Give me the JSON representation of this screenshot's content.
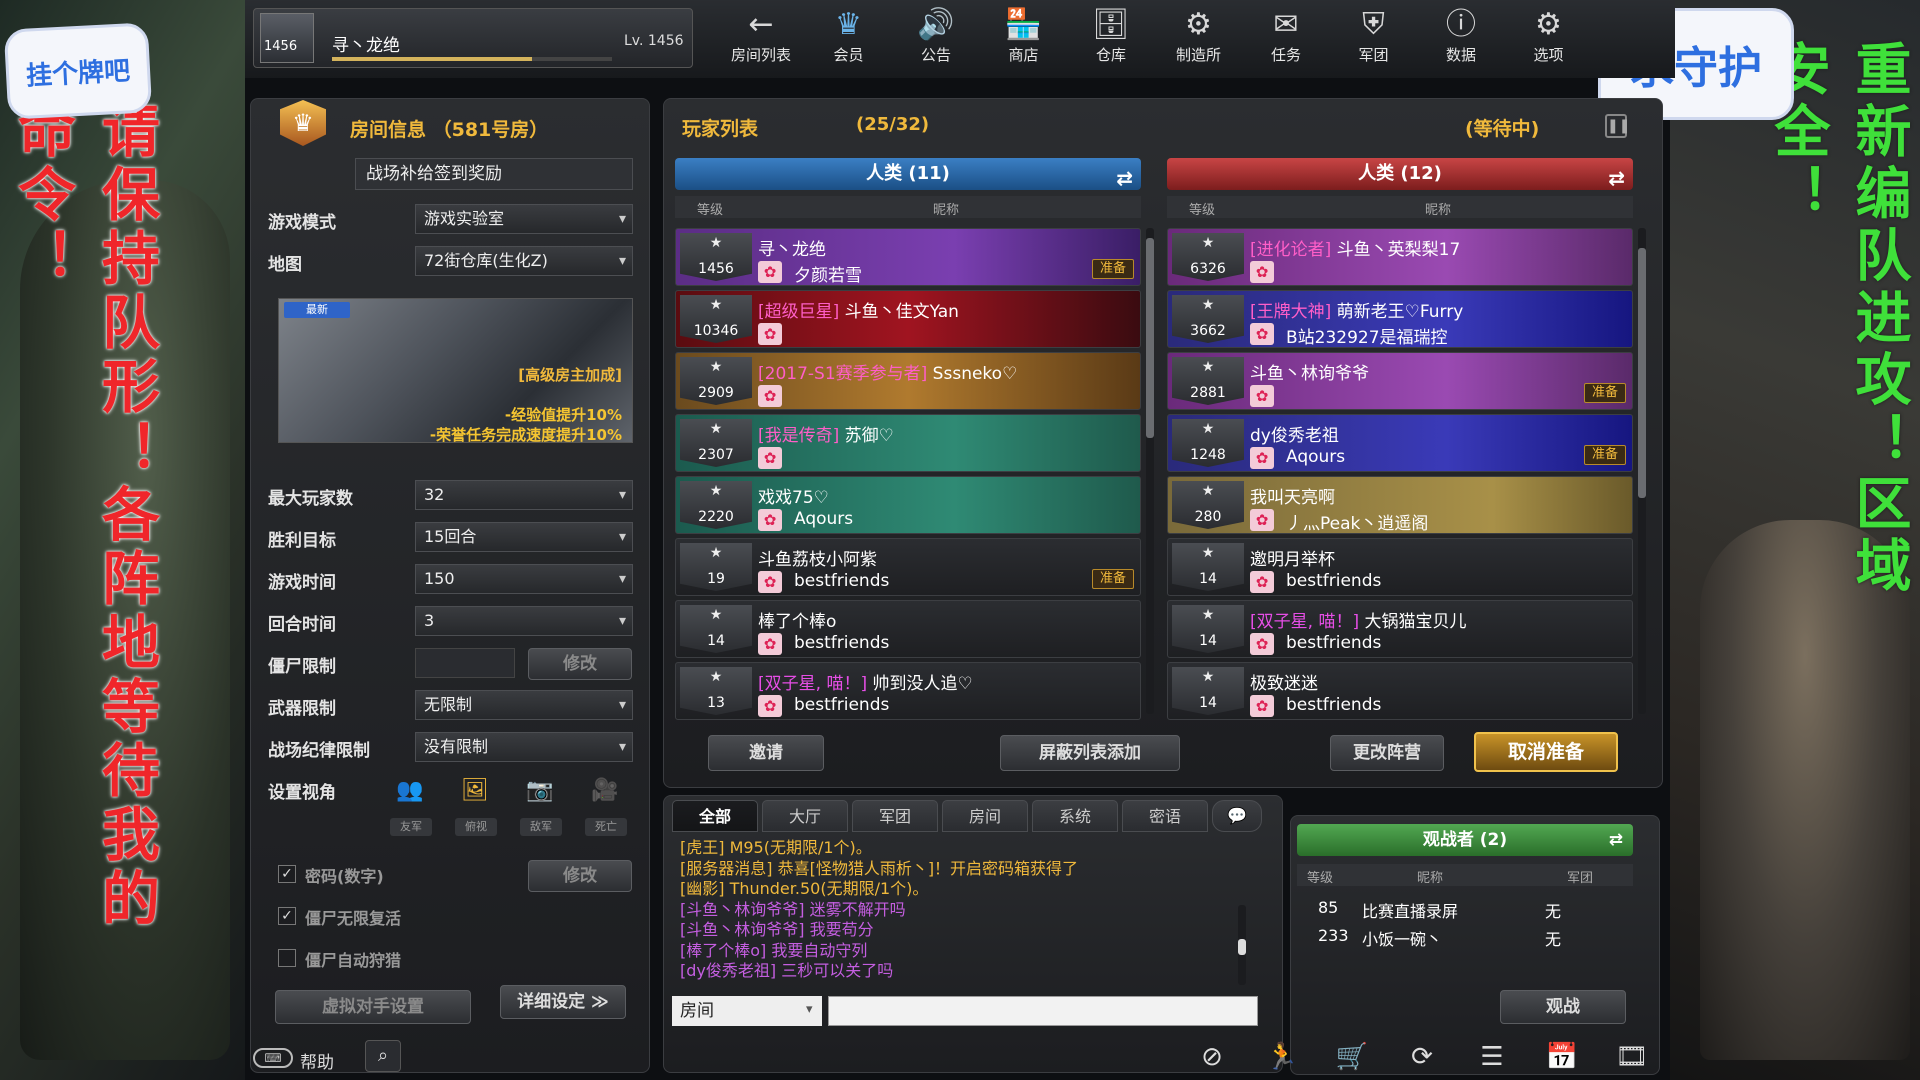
{
  "overlay": {
    "left_sticker": "挂个牌吧",
    "right_sticker": "求守护",
    "left_message": "请保持队形！各阵地等待我的命令！",
    "right_message": "重新编队进攻！区域安全！"
  },
  "profile": {
    "rank": "1456",
    "name": "寻丶龙绝",
    "level": "Lv. 1456"
  },
  "menu": [
    {
      "label": "房间列表",
      "icon": "←"
    },
    {
      "label": "会员",
      "icon": "♛"
    },
    {
      "label": "公告",
      "icon": "🔊"
    },
    {
      "label": "商店",
      "icon": "🏪"
    },
    {
      "label": "仓库",
      "icon": "🗄"
    },
    {
      "label": "制造所",
      "icon": "⚙"
    },
    {
      "label": "任务",
      "icon": "✉"
    },
    {
      "label": "军团",
      "icon": "⛨"
    },
    {
      "label": "数据",
      "icon": "ⓘ"
    },
    {
      "label": "选项",
      "icon": "⚙"
    }
  ],
  "room": {
    "title": "房间信息 （581号房）",
    "name": "战场补给签到奖励",
    "settings": [
      {
        "label": "游戏模式",
        "value": "游戏实验室"
      },
      {
        "label": "地图",
        "value": "72街仓库(生化Z)"
      }
    ],
    "map_badge": "最新",
    "map_bonus_title": "[高级房主加成]",
    "map_bonus_1": "-经验值提升10%",
    "map_bonus_2": "-荣誉任务完成速度提升10%",
    "settings2": [
      {
        "label": "最大玩家数",
        "value": "32"
      },
      {
        "label": "胜利目标",
        "value": "15回合"
      },
      {
        "label": "游戏时间",
        "value": "150"
      },
      {
        "label": "回合时间",
        "value": "3"
      }
    ],
    "zombie_limit_label": "僵尸限制",
    "modify_label": "修改",
    "weapon_label": "武器限制",
    "weapon_value": "无限制",
    "discipline_label": "战场纪律限制",
    "discipline_value": "没有限制",
    "view_label": "设置视角",
    "view_opts": [
      "友军",
      "俯视",
      "敌军",
      "死亡"
    ],
    "checks": [
      {
        "label": "密码(数字)",
        "checked": "✓"
      },
      {
        "label": "僵尸无限复活",
        "checked": "✓"
      },
      {
        "label": "僵尸自动狩猎",
        "checked": ""
      }
    ],
    "modify2_label": "修改",
    "bot_label": "虚拟对手设置",
    "detail_label": "详细设定 ≫"
  },
  "players": {
    "title": "玩家列表",
    "count": "(25/32)",
    "status": "(等待中)",
    "col_level": "等级",
    "col_name": "昵称",
    "team_a": {
      "label": "人类 (11)",
      "rows": [
        {
          "lvl": "1456",
          "title": "",
          "name": "寻丶龙绝",
          "sub": "夕颜若雪",
          "ready": "准备",
          "style": "g1"
        },
        {
          "lvl": "10346",
          "title": "[超级巨星]",
          "name": " 斗鱼丶佳文Yan",
          "sub": "",
          "ready": "",
          "style": "g2"
        },
        {
          "lvl": "2909",
          "title": "[2017-S1赛季参与者]",
          "name": " Sssneko♡",
          "sub": "",
          "ready": "",
          "style": "g3"
        },
        {
          "lvl": "2307",
          "title": "[我是传奇]",
          "name": " 苏御♡",
          "sub": "",
          "ready": "",
          "style": "g4"
        },
        {
          "lvl": "2220",
          "title": "",
          "name": "戏戏75♡",
          "sub": "Aqours",
          "ready": "",
          "style": "g4"
        },
        {
          "lvl": "19",
          "title": "",
          "name": "斗鱼荔枝小阿紫",
          "sub": "bestfriends",
          "ready": "准备",
          "style": ""
        },
        {
          "lvl": "14",
          "title": "",
          "name": "棒了个棒o",
          "sub": "bestfriends",
          "ready": "",
          "style": ""
        },
        {
          "lvl": "13",
          "title": "[双子星, 喵！]",
          "name": " 帅到没人追♡",
          "sub": "bestfriends",
          "ready": "",
          "style": ""
        }
      ]
    },
    "team_b": {
      "label": "人类 (12)",
      "rows": [
        {
          "lvl": "6326",
          "title": "[进化论者]",
          "name": " 斗鱼丶英梨梨17",
          "sub": "",
          "ready": "",
          "style": "g5"
        },
        {
          "lvl": "3662",
          "title": "[王牌大神]",
          "name": " 萌新老王♡Furry",
          "sub": "B站232927是福瑞控",
          "ready": "",
          "style": "g6"
        },
        {
          "lvl": "2881",
          "title": "",
          "name": "斗鱼丶林询爷爷",
          "sub": "",
          "ready": "准备",
          "style": "g5"
        },
        {
          "lvl": "1248",
          "title": "",
          "name": "dy俊秀老祖",
          "sub": "Aqours",
          "ready": "准备",
          "style": "g6"
        },
        {
          "lvl": "280",
          "title": "",
          "name": "我叫天亮啊",
          "sub": "丿灬Peak丶逍遥阁",
          "ready": "",
          "style": "g7"
        },
        {
          "lvl": "14",
          "title": "",
          "name": "邀明月举杯",
          "sub": "bestfriends",
          "ready": "",
          "style": ""
        },
        {
          "lvl": "14",
          "title": "[双子星, 喵！]",
          "name": " 大锅猫宝贝儿",
          "sub": "bestfriends",
          "ready": "",
          "style": ""
        },
        {
          "lvl": "14",
          "title": "",
          "name": "极致迷迷",
          "sub": "bestfriends",
          "ready": "",
          "style": ""
        }
      ]
    },
    "invite": "邀请",
    "block": "屏蔽列表添加",
    "change_team": "更改阵营",
    "cancel_ready": "取消准备"
  },
  "chat": {
    "tabs": [
      "全部",
      "大厅",
      "军团",
      "房间",
      "系统",
      "密语"
    ],
    "lines": [
      {
        "text": "[虎王] M95(无期限/1个)。",
        "color": "#f0b93c"
      },
      {
        "text": "[服务器消息] 恭喜[怪物猎人雨析丶]！开启密码箱获得了",
        "color": "#f0b93c"
      },
      {
        "text": "[幽影] Thunder.50(无期限/1个)。",
        "color": "#f0b93c"
      },
      {
        "text": "[斗鱼丶林询爷爷] 迷雾不解开吗",
        "color": "#c45ee0"
      },
      {
        "text": "[斗鱼丶林询爷爷] 我要苟分",
        "color": "#c45ee0"
      },
      {
        "text": "[棒了个棒o] 我要自动守列",
        "color": "#c45ee0"
      },
      {
        "text": "[dy俊秀老祖] 三秒可以关了吗",
        "color": "#c45ee0"
      }
    ],
    "channel": "房间"
  },
  "spectators": {
    "label": "观战者 (2)",
    "col_level": "等级",
    "col_name": "昵称",
    "col_clan": "军团",
    "rows": [
      {
        "lvl": "85",
        "name": "比赛直播录屏",
        "clan": "无"
      },
      {
        "lvl": "233",
        "name": "小饭一碗丶",
        "clan": "无"
      }
    ],
    "watch": "观战"
  },
  "footer": {
    "help": "帮助"
  }
}
